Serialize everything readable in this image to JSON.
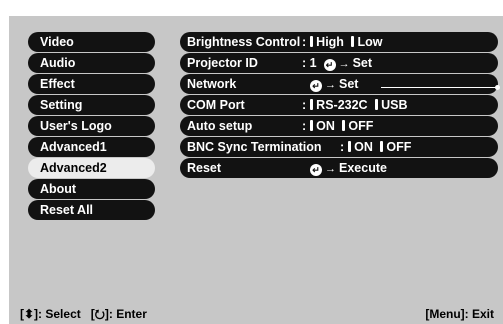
{
  "menu": [
    {
      "label": "Video",
      "selected": false
    },
    {
      "label": "Audio",
      "selected": false
    },
    {
      "label": "Effect",
      "selected": false
    },
    {
      "label": "Setting",
      "selected": false
    },
    {
      "label": "User's Logo",
      "selected": false
    },
    {
      "label": "Advanced1",
      "selected": false
    },
    {
      "label": "Advanced2",
      "selected": true
    },
    {
      "label": "About",
      "selected": false
    },
    {
      "label": "Reset All",
      "selected": false
    }
  ],
  "rows": {
    "brightness": {
      "label": "Brightness Control",
      "sep": ":",
      "opt1": "High",
      "opt2": "Low"
    },
    "projector_id": {
      "label": "Projector ID",
      "sep": ":",
      "value": "1",
      "action": "Set"
    },
    "network": {
      "label": "Network",
      "action": "Set"
    },
    "com_port": {
      "label": "COM Port",
      "sep": ":",
      "opt1": "RS-232C",
      "opt2": "USB"
    },
    "auto_setup": {
      "label": "Auto setup",
      "sep": ":",
      "opt1": "ON",
      "opt2": "OFF"
    },
    "bnc_sync": {
      "label": "BNC Sync Termination",
      "sep": ":",
      "opt1": "ON",
      "opt2": "OFF"
    },
    "reset": {
      "label": "Reset",
      "action": "Execute"
    }
  },
  "footer": {
    "select_key": "[⬍]",
    "select_label": ": Select",
    "enter_key": "[⭮]",
    "enter_label": ": Enter",
    "exit_text": "[Menu]: Exit"
  },
  "icons": {
    "enter": "enter-button-icon",
    "arrow": "right-arrow-icon",
    "updown": "up-down-arrow-icon"
  },
  "colors": {
    "background": "#c7c7c7",
    "pill": "#121212",
    "selected": "#ececec"
  }
}
